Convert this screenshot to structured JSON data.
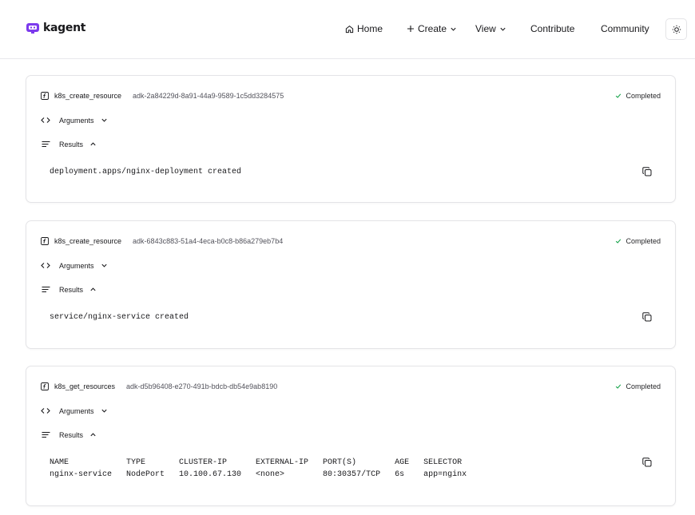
{
  "brand": {
    "name": "kagent",
    "accent": "#7c3aed"
  },
  "nav": {
    "home": "Home",
    "create": "Create",
    "view": "View",
    "contribute": "Contribute",
    "community": "Community"
  },
  "cards": [
    {
      "tool": "k8s_create_resource",
      "id": "adk-2a84229d-8a91-44a9-9589-1c5dd3284575",
      "status": "Completed",
      "arguments_label": "Arguments",
      "results_label": "Results",
      "result": "deployment.apps/nginx-deployment created"
    },
    {
      "tool": "k8s_create_resource",
      "id": "adk-6843c883-51a4-4eca-b0c8-b86a279eb7b4",
      "status": "Completed",
      "arguments_label": "Arguments",
      "results_label": "Results",
      "result": "service/nginx-service created"
    },
    {
      "tool": "k8s_get_resources",
      "id": "adk-d5b96408-e270-491b-bdcb-db54e9ab8190",
      "status": "Completed",
      "arguments_label": "Arguments",
      "results_label": "Results",
      "result": "NAME            TYPE       CLUSTER-IP      EXTERNAL-IP   PORT(S)        AGE   SELECTOR\nnginx-service   NodePort   10.100.67.130   <none>        80:30357/TCP   6s    app=nginx"
    }
  ],
  "icons": {
    "home": "home-icon",
    "plus": "plus-icon",
    "chevron": "chevron-down-icon",
    "sun": "sun-icon",
    "function": "function-icon",
    "check": "check-icon",
    "code": "code-icon",
    "lines": "text-lines-icon",
    "copy": "copy-icon"
  }
}
